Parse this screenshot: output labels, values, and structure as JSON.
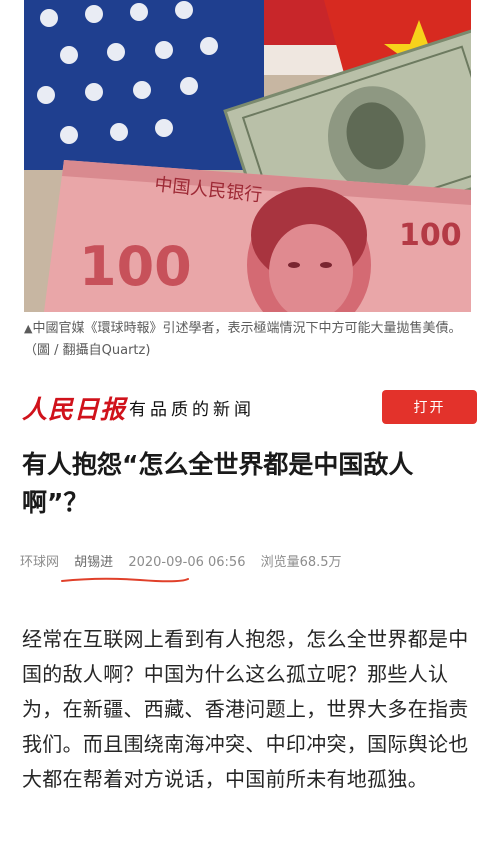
{
  "hero": {
    "description_alt": ""
  },
  "caption": {
    "marker": "▲",
    "text": "中國官媒《環球時報》引述學者，表示極端情況下中方可能大量拋售美債。（圖 / 翻攝自Quartz)"
  },
  "masthead": {
    "logo_text": "人民日报",
    "slogan": "有品质的新闻",
    "open_label": "打开"
  },
  "article": {
    "title": "有人抱怨“怎么全世界都是中国敌人啊”？",
    "source": "环球网",
    "author": "胡锡进",
    "datetime": "2020-09-06 06:56",
    "views": "浏览量68.5万",
    "body": "经常在互联网上看到有人抱怨，怎么全世界都是中国的敌人啊？中国为什么这么孤立呢？那些人认为，在新疆、西藏、香港问题上，世界大多在指责我们。而且围绕南海冲突、中印冲突，国际舆论也大都在帮着对方说话，中国前所未有地孤独。"
  },
  "colors": {
    "brand_red": "#d0121b",
    "button_red": "#e3322b",
    "annotation_red": "#e0402a"
  },
  "banknote_texts": {
    "yuan_denomination_left": "100",
    "yuan_denomination_right": "100",
    "yuan_header": "中国人民银行"
  }
}
